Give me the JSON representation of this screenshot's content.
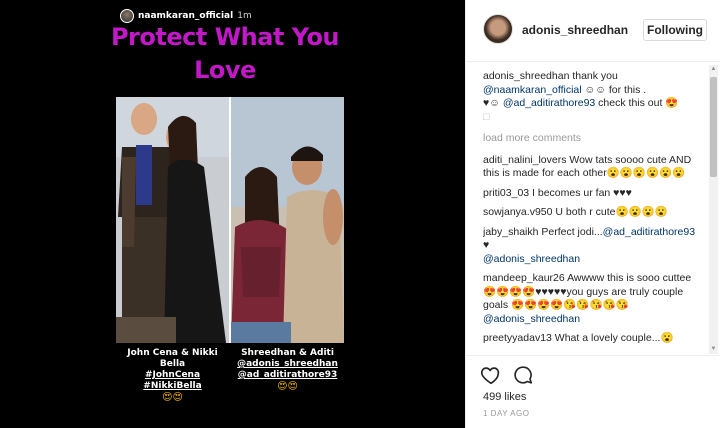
{
  "story": {
    "username": "naamkaran_official",
    "time": "1m",
    "headline_line1": "Protect What You",
    "headline_line2": "Love",
    "left_caption": {
      "line1": "John Cena & Nikki Bella",
      "line2": "#JohnCena",
      "line3": "#NikkiBella",
      "emoji": "😍😍"
    },
    "right_caption": {
      "line1": "Shreedhan & Aditi",
      "line2": "@adonis_shreedhan",
      "line3": "@ad_aditirathore93",
      "emoji": "😍😍"
    }
  },
  "post": {
    "username": "adonis_shreedhan",
    "follow_label": "Following",
    "caption": {
      "user": "adonis_shreedhan",
      "text1": " thank you ",
      "mention1": "@naamkaran_official",
      "text2": " ☺☺ for this .",
      "text3": "♥☺ ",
      "mention2": "@ad_aditirathore93",
      "text4": " check this out 😍",
      "text5": "□"
    },
    "load_more": "load more comments",
    "comments": [
      {
        "user": "aditi_nalini_lovers",
        "text": " Wow tats soooo cute AND this is made for each other😮😮😮😮😮😮"
      },
      {
        "user": "priti03_03",
        "text": " I becomes ur fan ♥♥♥"
      },
      {
        "user": "sowjanya.v950",
        "text": " U both r cute😮😮😮😮"
      },
      {
        "user": "jaby_shaikh",
        "text": " Perfect jodi...",
        "mention": "@ad_aditirathore93",
        "text_after": " ♥",
        "mention2": "@adonis_shreedhan"
      },
      {
        "user": "mandeep_kaur26",
        "text": " Awwww this is sooo cuttee 😍😍😍😍♥♥♥♥♥you guys are truly couple goals 😍😍😍😍😘😘😘😘😘",
        "mention": "@adonis_shreedhan"
      },
      {
        "user": "preetyyadav13",
        "text": " What a lovely couple...😮"
      }
    ],
    "likes": "499 likes",
    "ago": "1 DAY AGO"
  }
}
